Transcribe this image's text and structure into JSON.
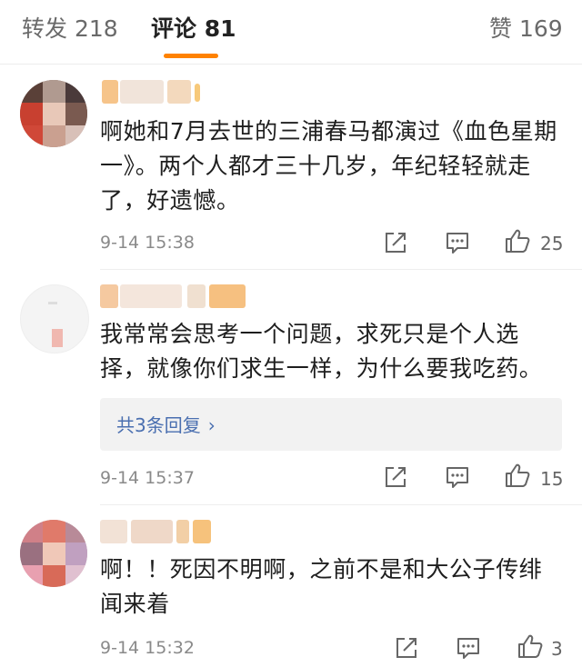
{
  "tabs": [
    {
      "label": "转发 218"
    },
    {
      "label": "评论 81",
      "active": true
    },
    {
      "label": "赞 169"
    }
  ],
  "comments": [
    {
      "text": "啊她和7月去世的三浦春马都演过《血色星期一》。两个人都才三十几岁，年纪轻轻就走了，好遗憾。",
      "time": "9-14 15:38",
      "likes": "25"
    },
    {
      "text": "我常常会思考一个问题，求死只是个人选择，就像你们求生一样，为什么要我吃药。",
      "reply_link": "共3条回复",
      "time": "9-14 15:37",
      "likes": "15"
    },
    {
      "text": "啊！！死因不明啊，之前不是和大公子传绯闻来着",
      "time": "9-14 15:32",
      "likes": "3"
    }
  ],
  "icons": {
    "share": "share-icon",
    "comment": "comment-icon",
    "like": "thumbs-up-icon"
  },
  "colors": {
    "accent": "#ff8200",
    "reply_link": "#4a6fb0",
    "muted": "#8a8a8a"
  }
}
